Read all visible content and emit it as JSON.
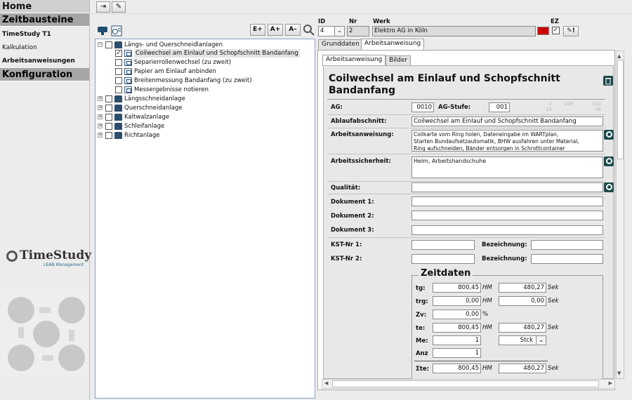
{
  "sidebar": {
    "home": "Home",
    "zeitbausteine": "Zeitbausteine",
    "timestudy": "TimeStudy T1",
    "kalkulation": "Kalkulation",
    "arbeitsanweisungen": "Arbeitsanweisungen",
    "konfiguration": "Konfiguration",
    "logo": "TimeStudy",
    "logo_sub": "LEAN Management"
  },
  "tree": {
    "buttons": [
      "E+",
      "A+",
      "A–"
    ],
    "root": "Längs- und Querschneidlanlagen",
    "children": [
      "Coilwechsel am Einlauf und Schopfschnitt Bandanfang",
      "Separierrollenwechsel (zu zweit)",
      "Papier am Einlauf anbinden",
      "Breitenmessung Bandanfang (zu zweit)",
      "Messergebnisse notieren"
    ],
    "nodes": [
      "Längsschneidanlage",
      "Querschneidanlage",
      "Kaltwalzanlage",
      "Schleifanlage",
      "Richtanlage"
    ]
  },
  "header": {
    "id_label": "ID",
    "id_value": "4",
    "nr_label": "Nr",
    "nr_value": "2",
    "werk_label": "Werk",
    "werk_value": "Elektro AG in Köln",
    "ez_label": "EZ",
    "ez_color": "#cc0000"
  },
  "tabs": {
    "outer": [
      "Grunddaten",
      "Arbeitsanweisung"
    ],
    "inner": [
      "Arbeitsanweisung",
      "Bilder"
    ]
  },
  "form": {
    "title": "Coilwechsel am Einlauf und Schopfschnitt Bandanfang",
    "ag_label": "AG:",
    "ag_value": "0010",
    "agstufe_label": "AG-Stufe:",
    "agstufe_value": "001",
    "faint": [
      "2",
      "106",
      "310",
      "10",
      "46"
    ],
    "ablauf_label": "Ablaufabschnitt:",
    "ablauf_value": "Coilwechsel am Einlauf und Schopfschnitt Bandanfang",
    "anweisung_label": "Arbeitsanweisung:",
    "anweisung_lines": [
      "Coilkarte vom Ring holen, Dateneingabe im WARTplan,",
      "Starten Bundaufsetzautomatik, BHW ausfahren unter Material,",
      "Ring aufschneiden, Bänder entsorgen in Schrottcontainer"
    ],
    "sicherheit_label": "Arbeitssicherheit:",
    "sicherheit_value": "Helm, Arbeitshandschuhe",
    "qualitaet_label": "Qualität:",
    "dok1_label": "Dokument 1:",
    "dok2_label": "Dokument 2:",
    "dok3_label": "Dokument 3:",
    "kst1_label": "KST-Nr 1:",
    "kst2_label": "KST-Nr 2:",
    "bez1_label": "Bezeichnung:",
    "bez2_label": "Bezeichnung:"
  },
  "zeitdaten": {
    "title": "Zeitdaten",
    "tg_label": "tg:",
    "tg_hm": "800,45",
    "tg_sek": "480,27",
    "trg_label": "trg:",
    "trg_hm": "0,00",
    "trg_sek": "0,00",
    "zv_label": "Zv:",
    "zv_value": "0,00",
    "zv_unit": "%",
    "te_label": "te:",
    "te_hm": "800,45",
    "te_sek": "480,27",
    "me_label": "Me:",
    "me_value": "1",
    "me_unit": "Stck",
    "anz_label": "Anz",
    "anz_value": "1",
    "ste_label": "Σte:",
    "ste_hm": "800,45",
    "ste_sek": "480,27",
    "hm": "HM",
    "sek": "Sek"
  }
}
